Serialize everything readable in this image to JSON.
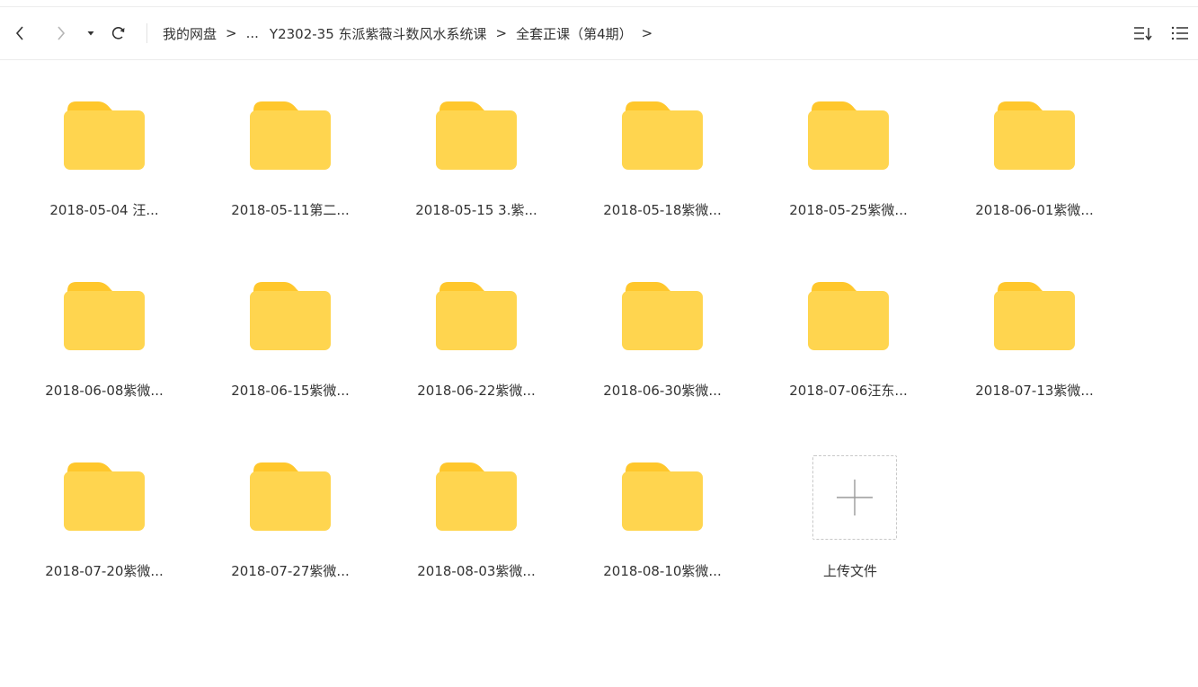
{
  "breadcrumb": {
    "items": [
      "我的网盘",
      "...",
      "Y2302-35 东派紫薇斗数风水系统课",
      "全套正课（第4期）"
    ],
    "separator": ">"
  },
  "icons": {
    "back": "chevron-left-icon",
    "forward": "chevron-right-icon",
    "history": "dropdown-arrow-icon",
    "refresh": "refresh-icon",
    "sort": "sort-icon",
    "list_view": "list-view-icon",
    "folder": "folder-icon",
    "upload": "plus-icon"
  },
  "colors": {
    "folder_body": "#FFD54F",
    "folder_tab": "#FFC72C"
  },
  "folders": [
    "2018-05-04 汪...",
    "2018-05-11第二...",
    "2018-05-15 3.紫...",
    "2018-05-18紫微...",
    "2018-05-25紫微...",
    "2018-06-01紫微...",
    "2018-06-08紫微...",
    "2018-06-15紫微...",
    "2018-06-22紫微...",
    "2018-06-30紫微...",
    "2018-07-06汪东...",
    "2018-07-13紫微...",
    "2018-07-20紫微...",
    "2018-07-27紫微...",
    "2018-08-03紫微...",
    "2018-08-10紫微..."
  ],
  "upload": {
    "label": "上传文件"
  }
}
